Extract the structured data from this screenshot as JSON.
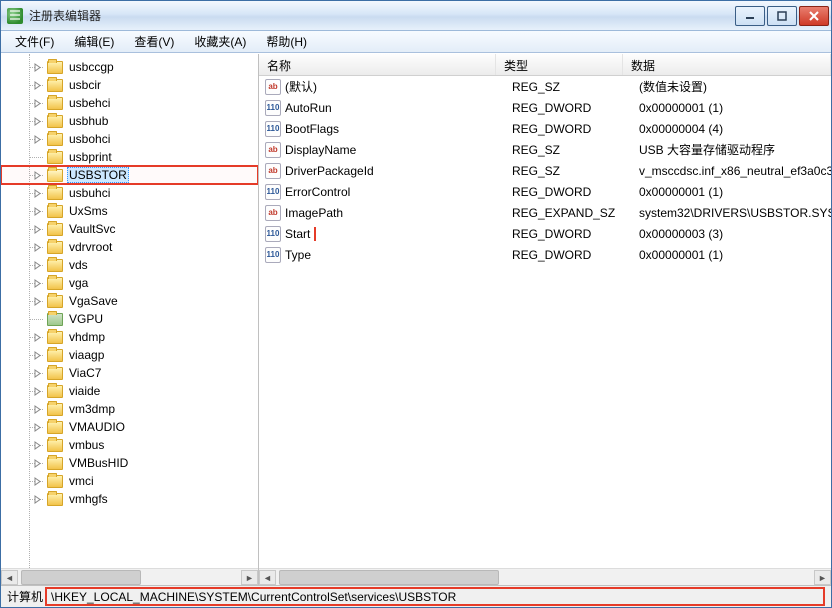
{
  "window": {
    "title": "注册表编辑器"
  },
  "menus": {
    "file": "文件(F)",
    "edit": "编辑(E)",
    "view": "查看(V)",
    "favorites": "收藏夹(A)",
    "help": "帮助(H)"
  },
  "tree": {
    "items": [
      {
        "label": "usbccgp",
        "hasChildren": true
      },
      {
        "label": "usbcir",
        "hasChildren": true
      },
      {
        "label": "usbehci",
        "hasChildren": true
      },
      {
        "label": "usbhub",
        "hasChildren": true
      },
      {
        "label": "usbohci",
        "hasChildren": true
      },
      {
        "label": "usbprint",
        "hasChildren": false
      },
      {
        "label": "USBSTOR",
        "hasChildren": true,
        "selected": true,
        "highlighted": true
      },
      {
        "label": "usbuhci",
        "hasChildren": true
      },
      {
        "label": "UxSms",
        "hasChildren": true
      },
      {
        "label": "VaultSvc",
        "hasChildren": true
      },
      {
        "label": "vdrvroot",
        "hasChildren": true
      },
      {
        "label": "vds",
        "hasChildren": true
      },
      {
        "label": "vga",
        "hasChildren": true
      },
      {
        "label": "VgaSave",
        "hasChildren": true
      },
      {
        "label": "VGPU",
        "hasChildren": false,
        "special": true
      },
      {
        "label": "vhdmp",
        "hasChildren": true
      },
      {
        "label": "viaagp",
        "hasChildren": true
      },
      {
        "label": "ViaC7",
        "hasChildren": true
      },
      {
        "label": "viaide",
        "hasChildren": true
      },
      {
        "label": "vm3dmp",
        "hasChildren": true
      },
      {
        "label": "VMAUDIO",
        "hasChildren": true
      },
      {
        "label": "vmbus",
        "hasChildren": true
      },
      {
        "label": "VMBusHID",
        "hasChildren": true
      },
      {
        "label": "vmci",
        "hasChildren": true
      },
      {
        "label": "vmhgfs",
        "hasChildren": true
      }
    ]
  },
  "columns": {
    "name": "名称",
    "type": "类型",
    "data": "数据"
  },
  "values": [
    {
      "icon": "sz",
      "name": "(默认)",
      "type": "REG_SZ",
      "data": "(数值未设置)"
    },
    {
      "icon": "dw",
      "name": "AutoRun",
      "type": "REG_DWORD",
      "data": "0x00000001 (1)"
    },
    {
      "icon": "dw",
      "name": "BootFlags",
      "type": "REG_DWORD",
      "data": "0x00000004 (4)"
    },
    {
      "icon": "sz",
      "name": "DisplayName",
      "type": "REG_SZ",
      "data": "USB 大容量存储驱动程序"
    },
    {
      "icon": "sz",
      "name": "DriverPackageId",
      "type": "REG_SZ",
      "data": "v_msccdsc.inf_x86_neutral_ef3a0c3"
    },
    {
      "icon": "dw",
      "name": "ErrorControl",
      "type": "REG_DWORD",
      "data": "0x00000001 (1)"
    },
    {
      "icon": "sz",
      "name": "ImagePath",
      "type": "REG_EXPAND_SZ",
      "data": "system32\\DRIVERS\\USBSTOR.SYS"
    },
    {
      "icon": "dw",
      "name": "Start",
      "type": "REG_DWORD",
      "data": "0x00000003 (3)",
      "highlighted": true
    },
    {
      "icon": "dw",
      "name": "Type",
      "type": "REG_DWORD",
      "data": "0x00000001 (1)"
    }
  ],
  "status": {
    "prefix": "计算机",
    "path": "\\HKEY_LOCAL_MACHINE\\SYSTEM\\CurrentControlSet\\services\\USBSTOR"
  }
}
